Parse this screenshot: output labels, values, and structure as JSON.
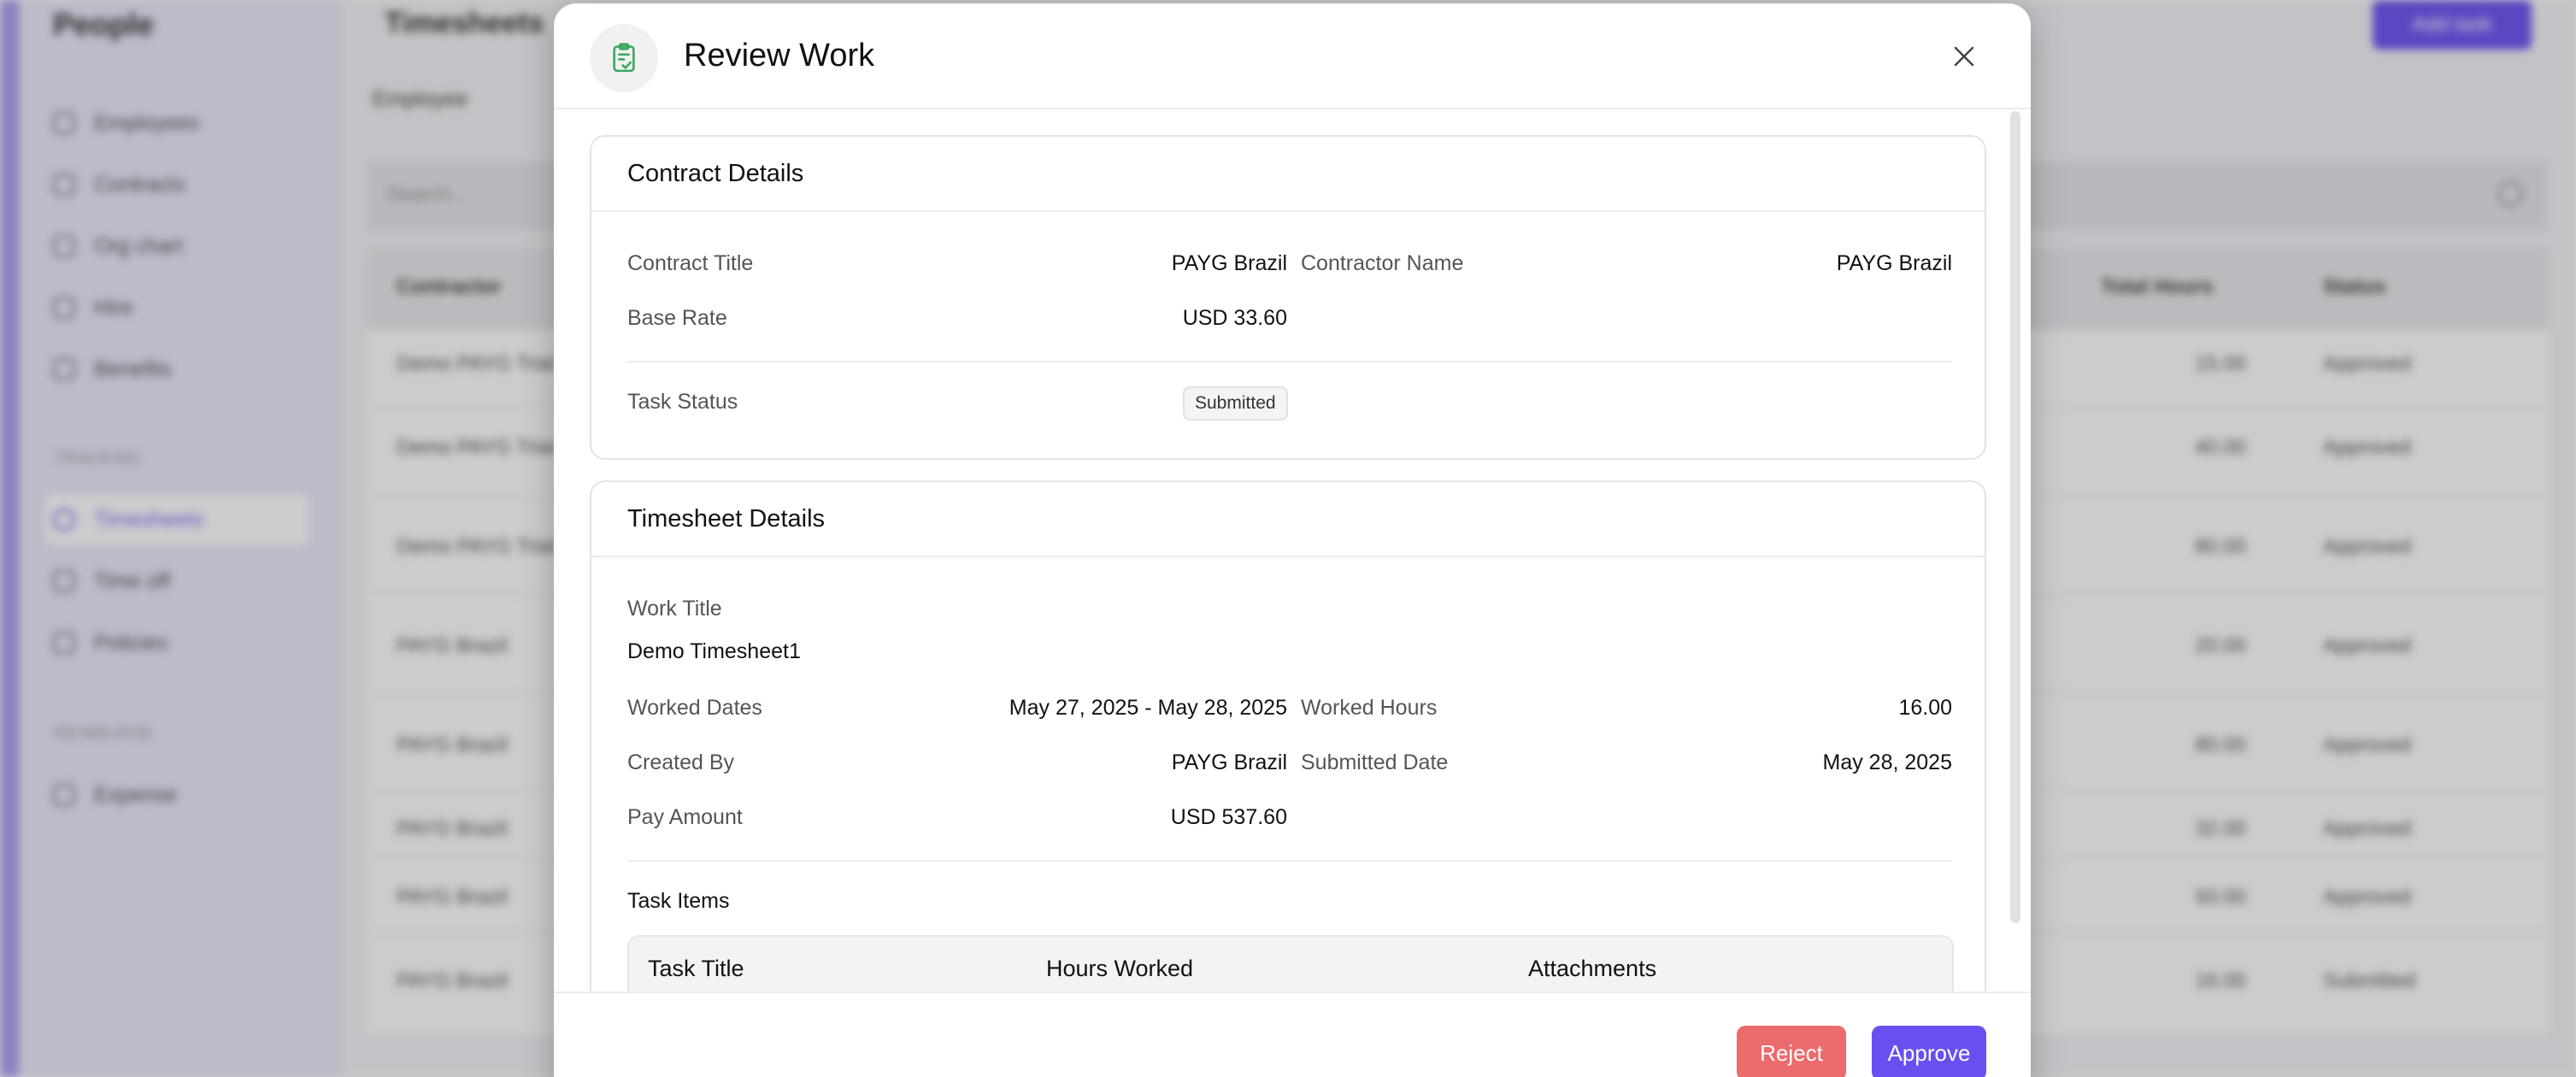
{
  "background": {
    "brand": "People",
    "nav": [
      "Employees",
      "Contracts",
      "Org chart",
      "Hire",
      "Benefits"
    ],
    "section_time": "TRACKING",
    "nav_time": [
      "Timesheets",
      "Time off",
      "Policies"
    ],
    "section_money": "REIMBURSE",
    "nav_money": [
      "Expense"
    ],
    "page_title": "Timesheets",
    "add_button": "Add task",
    "tab": "Employee",
    "search_placeholder": "Search...",
    "columns": [
      "Contractor",
      "Total Hours",
      "Status"
    ],
    "rows": [
      {
        "name": "Demo PAYG Trial",
        "hours": "15.00",
        "status": "Approved"
      },
      {
        "name": "Demo PAYG Trial",
        "hours": "40.00",
        "status": "Approved"
      },
      {
        "name": "Demo PAYG Trial",
        "hours": "80.00",
        "status": "Approved"
      },
      {
        "name": "PAYG Brazil",
        "hours": "20.00",
        "status": "Approved"
      },
      {
        "name": "PAYG Brazil",
        "hours": "80.00",
        "status": "Approved"
      },
      {
        "name": "PAYG Brazil",
        "hours": "32.00",
        "status": "Approved"
      },
      {
        "name": "PAYG Brazil",
        "hours": "50.00",
        "status": "Approved"
      },
      {
        "name": "PAYG Brazil",
        "hours": "16.00",
        "status": "Submitted"
      }
    ]
  },
  "modal": {
    "title": "Review Work",
    "contract": {
      "heading": "Contract Details",
      "contract_title_label": "Contract Title",
      "contract_title_value": "PAYG Brazil",
      "contractor_name_label": "Contractor Name",
      "contractor_name_value": "PAYG Brazil",
      "base_rate_label": "Base Rate",
      "base_rate_value": "USD 33.60",
      "task_status_label": "Task Status",
      "task_status_value": "Submitted"
    },
    "timesheet": {
      "heading": "Timesheet Details",
      "work_title_label": "Work Title",
      "work_title_value": "Demo Timesheet1",
      "worked_dates_label": "Worked Dates",
      "worked_dates_value": "May 27, 2025 - May 28, 2025",
      "worked_hours_label": "Worked Hours",
      "worked_hours_value": "16.00",
      "created_by_label": "Created By",
      "created_by_value": "PAYG Brazil",
      "submitted_date_label": "Submitted Date",
      "submitted_date_value": "May 28, 2025",
      "pay_amount_label": "Pay Amount",
      "pay_amount_value": "USD 537.60",
      "task_items_label": "Task Items",
      "task_columns": [
        "Task Title",
        "Hours Worked",
        "Attachments"
      ]
    },
    "reject_label": "Reject",
    "approve_label": "Approve"
  },
  "colors": {
    "accent": "#6a4ff0",
    "reject": "#ec6b6d",
    "header_icon": "#3aa55d"
  }
}
